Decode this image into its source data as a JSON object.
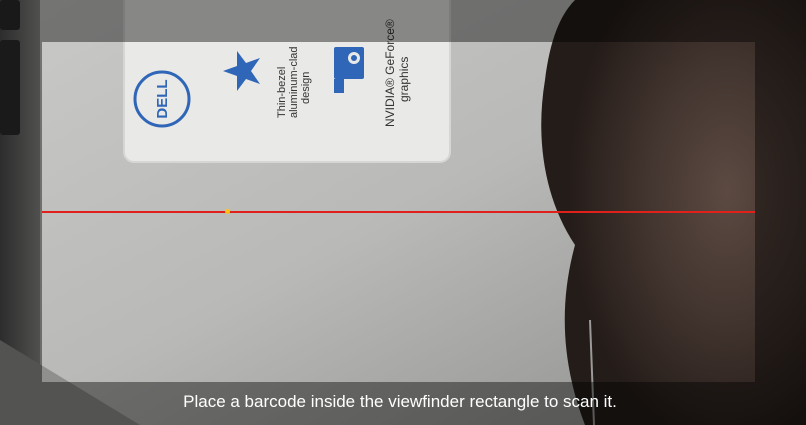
{
  "status": {
    "text": "Place a barcode inside the viewfinder rectangle to scan it."
  },
  "camera": {
    "sticker": {
      "brand": "DELL",
      "feature_lines": [
        "Thin-bezel",
        "aluminum-clad",
        "design"
      ],
      "gpu_lines": [
        "NVIDIA® GeForce®",
        "graphics"
      ]
    }
  },
  "colors": {
    "laser": "#e0201b",
    "result_point": "#ffc21a",
    "overlay": "rgba(0,0,0,0.42)",
    "status_text": "#ffffff",
    "sticker_blue": "#2f66b8"
  }
}
